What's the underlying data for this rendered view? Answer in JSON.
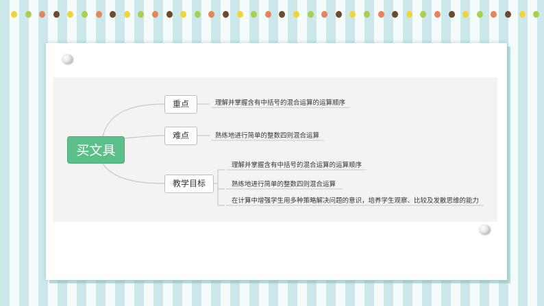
{
  "decor": {
    "dot_colors": [
      "#f1d33b",
      "#a9cf4e",
      "#e8845b",
      "#6e4a2d"
    ]
  },
  "mindmap": {
    "root": "买文具",
    "branches": [
      {
        "label": "重点",
        "items": [
          "理解并掌握含有中括号的混合运算的运算顺序"
        ]
      },
      {
        "label": "难点",
        "items": [
          "熟练地进行简单的整数四则混合运算"
        ]
      },
      {
        "label": "教学目标",
        "items": [
          "理解并掌握含有中括号的混合运算的运算顺序",
          "熟练地进行简单的整数四则混合运算",
          "在计算中增强学生用多种策略解决问题的意识，培养学生观察、比较及发散思维的能力"
        ]
      }
    ]
  },
  "colors": {
    "root_fill": "#5bbf8a",
    "line": "#c8c8c8",
    "stripe_dark": "#cde8ea",
    "stripe_light": "#f4fbfb"
  }
}
